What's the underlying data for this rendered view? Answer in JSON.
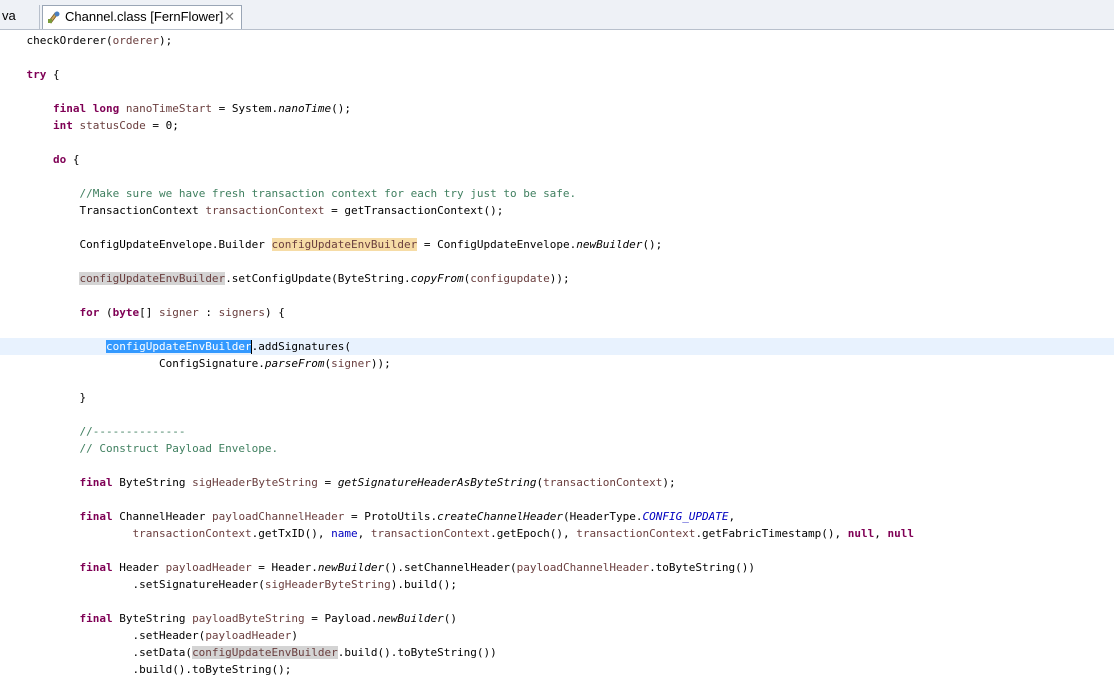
{
  "tabs": {
    "previous_label": "va",
    "active_label": "Channel.class [FernFlower]",
    "close_glyph": "✕"
  },
  "code": {
    "l1": {
      "a": "checkOrderer(",
      "b": "orderer",
      "c": ");"
    },
    "l2": {
      "kw": "try",
      "rest": " {"
    },
    "l3": {
      "kw1": "final",
      "kw2": "long",
      "v": "nanoTimeStart",
      "a": " = System.",
      "m": "nanoTime",
      "b": "();"
    },
    "l4": {
      "kw": "int",
      "v": "statusCode",
      "rest": " = 0;"
    },
    "l5": {
      "kw": "do",
      "rest": " {"
    },
    "l6": {
      "cmt": "//Make sure we have fresh transaction context for each try just to be safe."
    },
    "l7": {
      "a": "TransactionContext ",
      "v": "transactionContext",
      "b": " = getTransactionContext();"
    },
    "l8": {
      "a": "ConfigUpdateEnvelope.Builder ",
      "v": "configUpdateEnvBuilder",
      "b": " = ConfigUpdateEnvelope.",
      "m": "newBuilder",
      "c": "();"
    },
    "l9": {
      "v": "configUpdateEnvBuilder",
      "a": ".setConfigUpdate(ByteString.",
      "m": "copyFrom",
      "b": "(",
      "v2": "configupdate",
      "c": "));"
    },
    "l10": {
      "kw1": "for",
      "a": " (",
      "kw2": "byte",
      "b": "[] ",
      "v": "signer",
      "c": " : ",
      "v2": "signers",
      "d": ") {"
    },
    "l11": {
      "v": "configUpdateEnvBuilder",
      "a": ".addSignatures("
    },
    "l12": {
      "a": "ConfigSignature.",
      "m": "parseFrom",
      "b": "(",
      "v": "signer",
      "c": "));"
    },
    "l13": {
      "a": "}"
    },
    "l14": {
      "cmt": "//--------------"
    },
    "l15": {
      "cmt": "// Construct Payload Envelope."
    },
    "l16": {
      "kw": "final",
      "a": " ByteString ",
      "v": "sigHeaderByteString",
      "b": " = ",
      "m": "getSignatureHeaderAsByteString",
      "c": "(",
      "v2": "transactionContext",
      "d": ");"
    },
    "l17": {
      "kw": "final",
      "a": " ChannelHeader ",
      "v": "payloadChannelHeader",
      "b": " = ProtoUtils.",
      "m": "createChannelHeader",
      "c": "(HeaderType.",
      "f": "CONFIG_UPDATE",
      "d": ","
    },
    "l18": {
      "v": "transactionContext",
      "a": ".getTxID(), ",
      "f": "name",
      "b": ", ",
      "v2": "transactionContext",
      "c": ".getEpoch(), ",
      "v3": "transactionContext",
      "d": ".getFabricTimestamp(), ",
      "kw1": "null",
      "e": ", ",
      "kw2": "null"
    },
    "l19": {
      "kw": "final",
      "a": " Header ",
      "v": "payloadHeader",
      "b": " = Header.",
      "m": "newBuilder",
      "c": "().setChannelHeader(",
      "v2": "payloadChannelHeader",
      "d": ".toByteString())"
    },
    "l20": {
      "a": ".setSignatureHeader(",
      "v": "sigHeaderByteString",
      "b": ").build();"
    },
    "l21": {
      "kw": "final",
      "a": " ByteString ",
      "v": "payloadByteString",
      "b": " = Payload.",
      "m": "newBuilder",
      "c": "()"
    },
    "l22": {
      "a": ".setHeader(",
      "v": "payloadHeader",
      "b": ")"
    },
    "l23": {
      "a": ".setData(",
      "v": "configUpdateEnvBuilder",
      "b": ".build().toByteString())"
    },
    "l24": {
      "a": ".build().toByteString();"
    }
  }
}
